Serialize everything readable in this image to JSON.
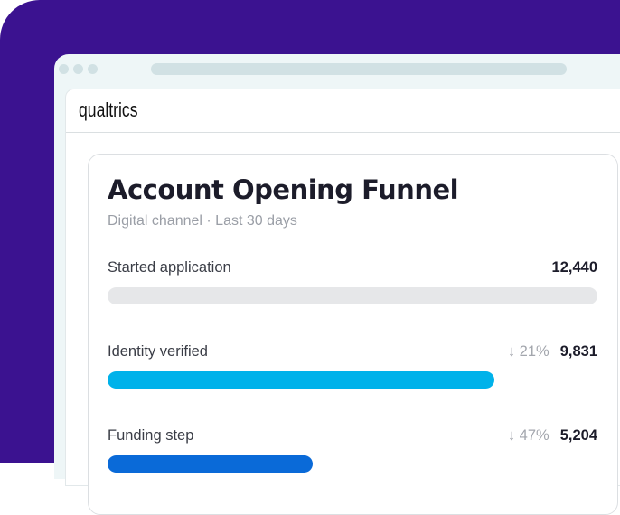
{
  "logo": "qualtrics",
  "card": {
    "title": "Account Opening Funnel",
    "subtitle": "Digital channel · Last 30 days"
  },
  "steps": [
    {
      "label": "Started application",
      "value": "12,440",
      "drop": null,
      "fraction": 1.0,
      "color": null
    },
    {
      "label": "Identity verified",
      "value": "9,831",
      "drop": "↓ 21%",
      "fraction": 0.79,
      "color": "#00b2ea"
    },
    {
      "label": "Funding step",
      "value": "5,204",
      "drop": "↓ 47%",
      "fraction": 0.418,
      "color": "#0a6ad8"
    }
  ]
}
